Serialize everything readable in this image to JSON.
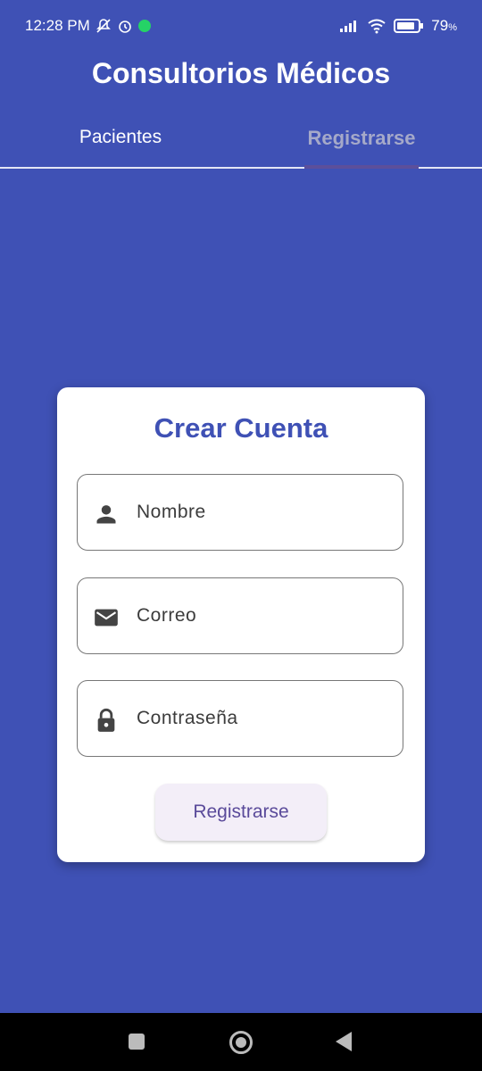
{
  "status_bar": {
    "time": "12:28 PM",
    "battery": "79",
    "battery_unit": "%",
    "icons": [
      "mute-icon",
      "alarm-icon",
      "whatsapp-icon",
      "signal-icon",
      "wifi-icon",
      "battery-icon"
    ]
  },
  "app": {
    "title": "Consultorios Médicos"
  },
  "tabs": [
    {
      "label": "Pacientes",
      "active": false
    },
    {
      "label": "Registrarse",
      "active": true
    }
  ],
  "form": {
    "title": "Crear Cuenta",
    "fields": [
      {
        "label": "Nombre",
        "icon": "person-icon"
      },
      {
        "label": "Correo",
        "icon": "email-icon"
      },
      {
        "label": "Contraseña",
        "icon": "lock-icon"
      }
    ],
    "submit_label": "Registrarse"
  },
  "colors": {
    "primary": "#3f51b5",
    "card": "#ffffff",
    "button_bg": "#f3eef8",
    "button_text": "#5a4a9a"
  }
}
